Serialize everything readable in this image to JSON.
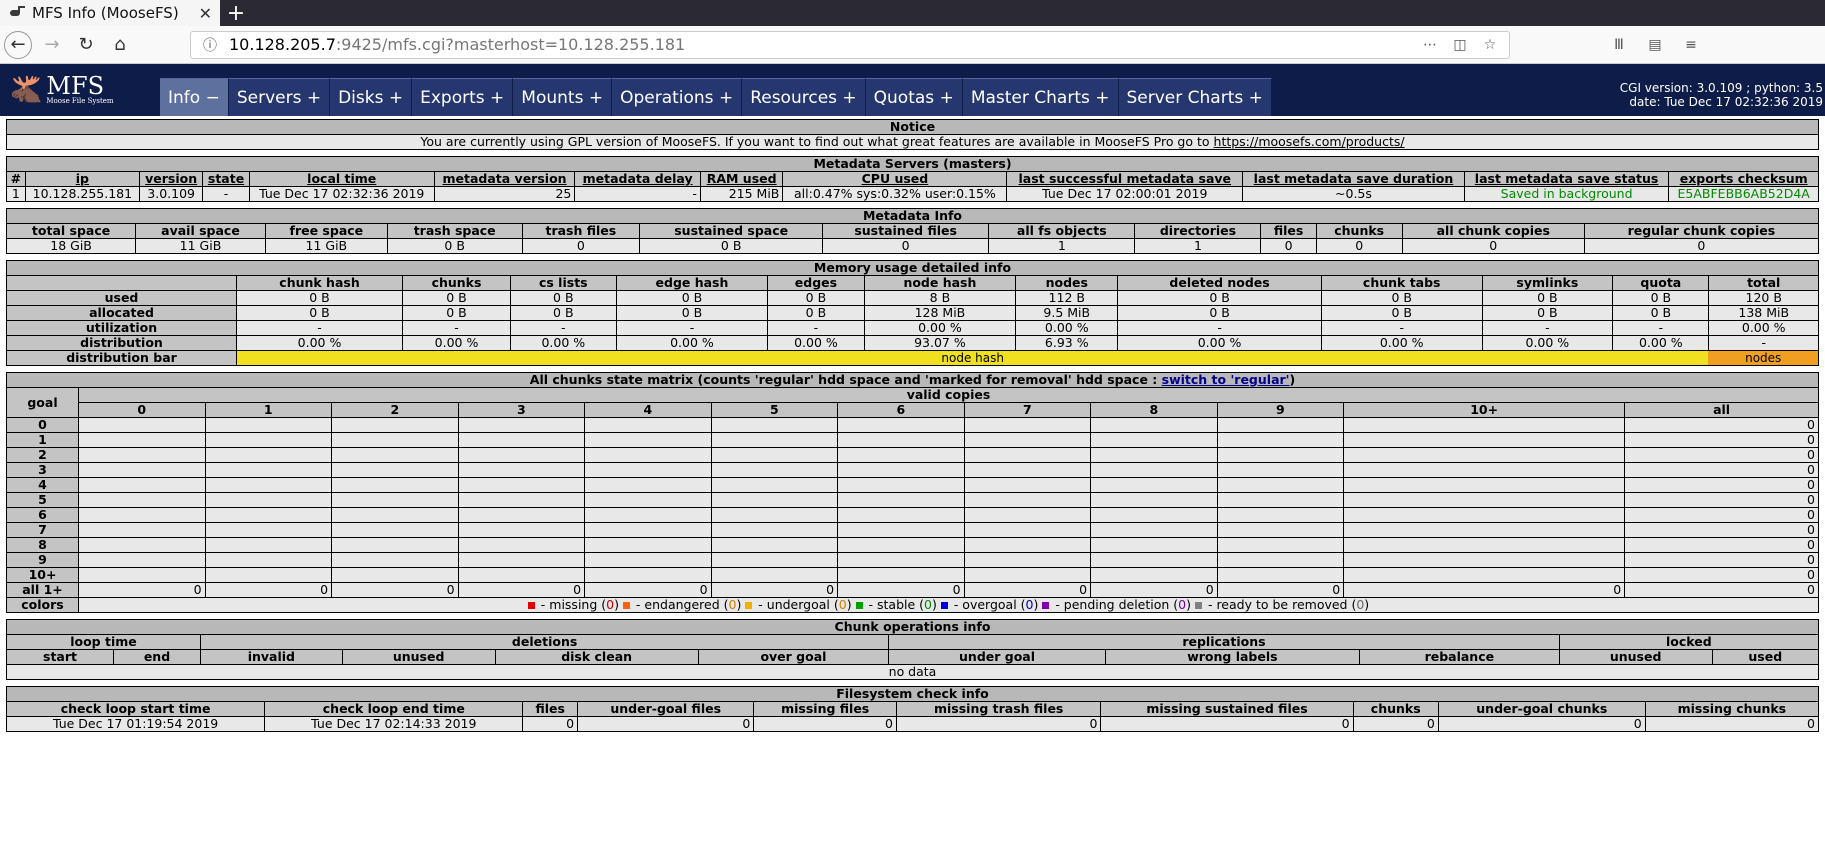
{
  "browser": {
    "tab_title": "MFS Info (MooseFS)",
    "tab_close": "✕",
    "new_tab": "+",
    "url_host": "10.128.205.7",
    "url_rest": ":9425/mfs.cgi?masterhost=10.128.255.181"
  },
  "mfs": {
    "logo_big": "MFS",
    "logo_small": "Moose File System",
    "menu": [
      "Info −",
      "Servers +",
      "Disks +",
      "Exports +",
      "Mounts +",
      "Operations +",
      "Resources +",
      "Quotas +",
      "Master Charts +",
      "Server Charts +"
    ],
    "cgi_line1": "CGI version: 3.0.109 ; python: 3.5",
    "cgi_line2": "date: Tue Dec 17 02:32:36 2019"
  },
  "notice": {
    "title": "Notice",
    "text": "You are currently using GPL version of MooseFS. If you want to find out what great features are available in MooseFS Pro go to ",
    "link": "https://moosefs.com/products/"
  },
  "masters": {
    "title": "Metadata Servers (masters)",
    "headers": [
      "#",
      "ip",
      "version",
      "state",
      "local time",
      "metadata version",
      "metadata delay",
      "RAM used",
      "CPU used",
      "last successful metadata save",
      "last metadata save duration",
      "last metadata save status",
      "exports checksum"
    ],
    "row": [
      "1",
      "10.128.255.181",
      "3.0.109",
      "-",
      "Tue Dec 17 02:32:36 2019",
      "25",
      "-",
      "215 MiB",
      "all:0.47% sys:0.32% user:0.15%",
      "Tue Dec 17 02:00:01 2019",
      "~0.5s",
      "Saved in background",
      "E5ABFEBB6AB52D4A"
    ]
  },
  "metainfo": {
    "title": "Metadata Info",
    "headers": [
      "total space",
      "avail space",
      "free space",
      "trash space",
      "trash files",
      "sustained space",
      "sustained files",
      "all fs objects",
      "directories",
      "files",
      "chunks",
      "all chunk copies",
      "regular chunk copies"
    ],
    "row": [
      "18 GiB",
      "11 GiB",
      "11 GiB",
      "0 B",
      "0",
      "0 B",
      "0",
      "1",
      "1",
      "0",
      "0",
      "0",
      "0"
    ]
  },
  "memory": {
    "title": "Memory usage detailed info",
    "headers": [
      "chunk hash",
      "chunks",
      "cs lists",
      "edge hash",
      "edges",
      "node hash",
      "nodes",
      "deleted nodes",
      "chunk tabs",
      "symlinks",
      "quota",
      "total"
    ],
    "rows": [
      {
        "label": "used",
        "values": [
          "0 B",
          "0 B",
          "0 B",
          "0 B",
          "0 B",
          "8 B",
          "112 B",
          "0 B",
          "0 B",
          "0 B",
          "0 B",
          "120 B"
        ]
      },
      {
        "label": "allocated",
        "values": [
          "0 B",
          "0 B",
          "0 B",
          "0 B",
          "0 B",
          "128 MiB",
          "9.5 MiB",
          "0 B",
          "0 B",
          "0 B",
          "0 B",
          "138 MiB"
        ]
      },
      {
        "label": "utilization",
        "values": [
          "-",
          "-",
          "-",
          "-",
          "-",
          "0.00 %",
          "0.00 %",
          "-",
          "-",
          "-",
          "-",
          "0.00 %"
        ]
      },
      {
        "label": "distribution",
        "values": [
          "0.00 %",
          "0.00 %",
          "0.00 %",
          "0.00 %",
          "0.00 %",
          "93.07 %",
          "6.93 %",
          "0.00 %",
          "0.00 %",
          "0.00 %",
          "0.00 %",
          "-"
        ]
      }
    ],
    "bar_label": "distribution bar",
    "bar_hash_label": "node hash",
    "bar_nodes_label": "nodes",
    "bar_hash_pct": 93.07,
    "bar_nodes_pct": 6.93
  },
  "matrix": {
    "title_pre": "All chunks state matrix (counts 'regular' hdd space and 'marked for removal' hdd space : ",
    "title_link": "switch to 'regular'",
    "title_post": ")",
    "goal_label": "goal",
    "valid_copies_label": "valid copies",
    "columns": [
      "0",
      "1",
      "2",
      "3",
      "4",
      "5",
      "6",
      "7",
      "8",
      "9",
      "10+",
      "all"
    ],
    "goals": [
      "0",
      "1",
      "2",
      "3",
      "4",
      "5",
      "6",
      "7",
      "8",
      "9",
      "10+"
    ],
    "all_label": "all 1+",
    "all_values": [
      "0",
      "0",
      "0",
      "0",
      "0",
      "0",
      "0",
      "0",
      "0",
      "0",
      "0",
      "0"
    ],
    "row_all_value": "0",
    "colors_label": "colors",
    "legend": [
      {
        "color": "#e00000",
        "text": " - missing (",
        "count": "0",
        "cls": "cnt"
      },
      {
        "color": "#ff6010",
        "text": " - endangered (",
        "count": "0",
        "cls": "orgcnt"
      },
      {
        "color": "#f0b000",
        "text": " - undergoal (",
        "count": "0",
        "cls": "orgcnt"
      },
      {
        "color": "#00a000",
        "text": " - stable (",
        "count": "0",
        "cls": "grncnt"
      },
      {
        "color": "#0000e0",
        "text": " - overgoal (",
        "count": "0",
        "cls": "bluecnt"
      },
      {
        "color": "#8000b0",
        "text": " - pending deletion (",
        "count": "0",
        "cls": "purcnt"
      },
      {
        "color": "#808080",
        "text": " - ready to be removed (",
        "count": "0",
        "cls": "grycnt"
      }
    ]
  },
  "chunkops": {
    "title": "Chunk operations info",
    "groups": [
      "loop time",
      "deletions",
      "replications",
      "locked"
    ],
    "headers": [
      "start",
      "end",
      "invalid",
      "unused",
      "disk clean",
      "over goal",
      "under goal",
      "wrong labels",
      "rebalance",
      "unused",
      "used"
    ],
    "nodata": "no data"
  },
  "fscheck": {
    "title": "Filesystem check info",
    "headers": [
      "check loop start time",
      "check loop end time",
      "files",
      "under-goal files",
      "missing files",
      "missing trash files",
      "missing sustained files",
      "chunks",
      "under-goal chunks",
      "missing chunks"
    ],
    "row": [
      "Tue Dec 17 01:19:54 2019",
      "Tue Dec 17 02:14:33 2019",
      "0",
      "0",
      "0",
      "0",
      "0",
      "0",
      "0",
      "0"
    ]
  }
}
